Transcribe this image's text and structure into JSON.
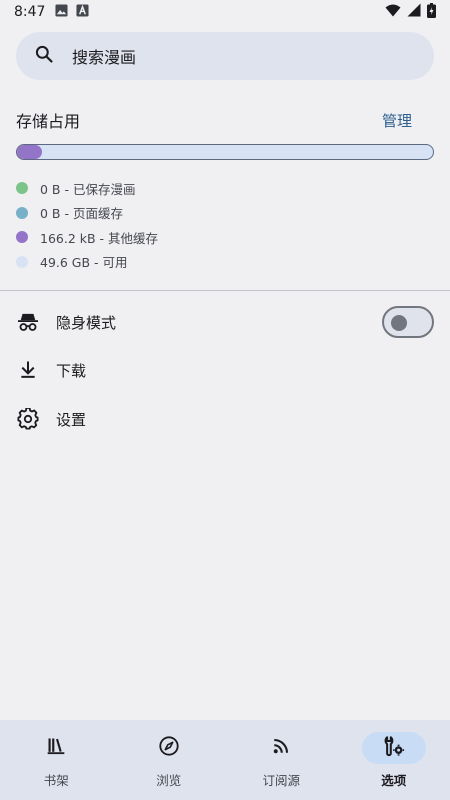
{
  "status_bar": {
    "time": "8:47"
  },
  "search": {
    "placeholder": "搜索漫画"
  },
  "storage": {
    "title": "存储占用",
    "manage_label": "管理",
    "used_fraction": 0.06,
    "legend": [
      {
        "text": "0 B - 已保存漫画",
        "color": "#7cc48a"
      },
      {
        "text": "0 B - 页面缓存",
        "color": "#78b0c8"
      },
      {
        "text": "166.2 kB - 其他缓存",
        "color": "#9474c8"
      },
      {
        "text": "49.6 GB - 可用",
        "color": "#d8e2f5"
      }
    ]
  },
  "menu": {
    "incognito_label": "隐身模式",
    "incognito_on": false,
    "downloads_label": "下载",
    "settings_label": "设置"
  },
  "bottom_nav": {
    "items": [
      {
        "label": "书架",
        "icon": "library-icon",
        "active": false
      },
      {
        "label": "浏览",
        "icon": "compass-icon",
        "active": false
      },
      {
        "label": "订阅源",
        "icon": "rss-icon",
        "active": false
      },
      {
        "label": "选项",
        "icon": "tools-icon",
        "active": true
      }
    ]
  },
  "colors": {
    "accent": "#2d5f8f",
    "background": "#f0f0f3",
    "surface": "#dfe3ee",
    "active_indicator": "#c8dcf5"
  }
}
